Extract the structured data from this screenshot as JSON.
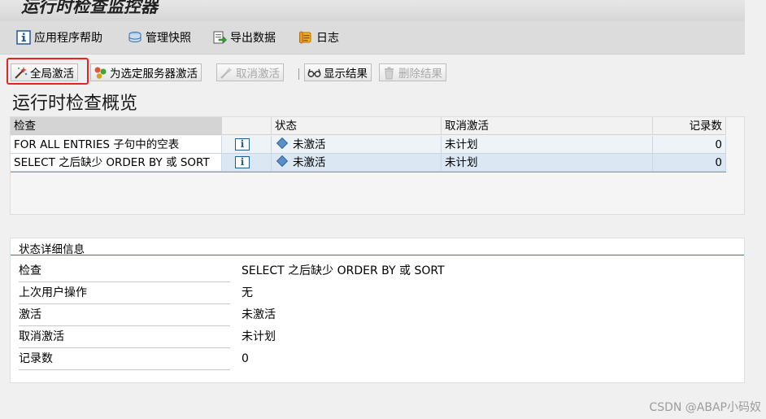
{
  "window": {
    "title": "运行时检查监控器"
  },
  "menu": {
    "items": [
      {
        "label": "应用程序帮助",
        "icon": "info-icon"
      },
      {
        "label": "管理快照",
        "icon": "database-icon"
      },
      {
        "label": "导出数据",
        "icon": "export-icon"
      },
      {
        "label": "日志",
        "icon": "log-scroll-icon"
      }
    ]
  },
  "toolbar": {
    "activate_all": "全局激活",
    "activate_server": "为选定服务器激活",
    "deactivate": "取消激活",
    "show_results": "显示结果",
    "delete_results": "删除结果"
  },
  "overview": {
    "title": "运行时检查概览",
    "columns": [
      "检查",
      "状态",
      "取消激活",
      "记录数"
    ],
    "rows": [
      {
        "check": "FOR ALL ENTRIES 子句中的空表",
        "status": "未激活",
        "deactivation": "未计划",
        "records": "0"
      },
      {
        "check": "SELECT 之后缺少 ORDER BY 或 SORT",
        "status": "未激活",
        "deactivation": "未计划",
        "records": "0"
      }
    ]
  },
  "details": {
    "title": "状态详细信息",
    "fields": [
      {
        "label": "检查",
        "value": "SELECT 之后缺少 ORDER BY 或 SORT"
      },
      {
        "label": "上次用户操作",
        "value": "无"
      },
      {
        "label": "激活",
        "value": "未激活"
      },
      {
        "label": "取消激活",
        "value": "未计划"
      },
      {
        "label": "记录数",
        "value": "0"
      }
    ]
  },
  "watermark": "CSDN @ABAP小码奴",
  "colors": {
    "highlight": "#e8231c",
    "selected_row": "#dbe8f4",
    "accent_blue": "#2a74c4"
  }
}
